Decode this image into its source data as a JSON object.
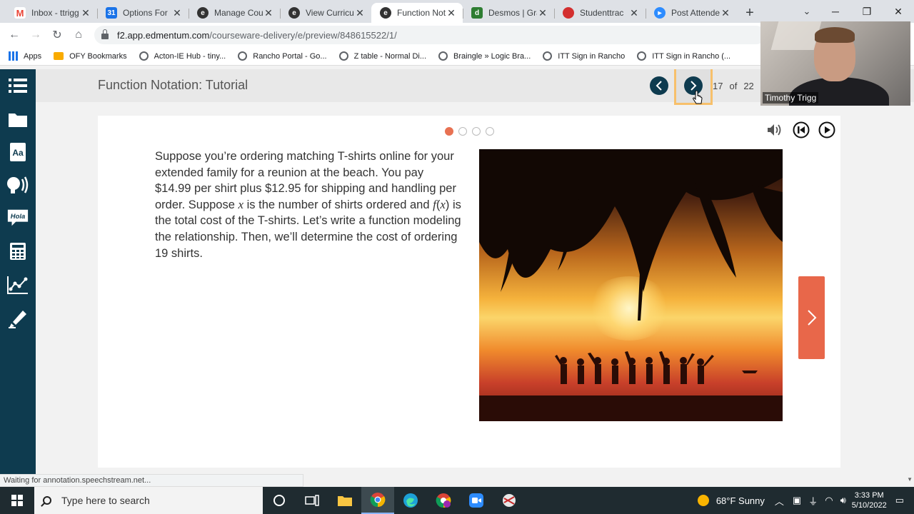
{
  "browser": {
    "tabs": [
      {
        "label": "Inbox - ttrigg",
        "icon": "gmail-icon",
        "color": "#ea4335",
        "active": false
      },
      {
        "label": "Options For",
        "icon": "calendar-icon",
        "color": "#1a73e8",
        "active": false
      },
      {
        "label": "Manage Cou",
        "icon": "edmentum-icon",
        "color": "#333333",
        "active": false
      },
      {
        "label": "View Curricu",
        "icon": "edmentum-icon",
        "color": "#333333",
        "active": false
      },
      {
        "label": "Function Not",
        "icon": "edmentum-icon",
        "color": "#333333",
        "active": true
      },
      {
        "label": "Desmos | Gra",
        "icon": "desmos-icon",
        "color": "#2e7d32",
        "active": false
      },
      {
        "label": "Studenttrac",
        "icon": "apple-icon",
        "color": "#d32f2f",
        "active": false
      },
      {
        "label": "Post Attende",
        "icon": "zoom-icon",
        "color": "#2d8cff",
        "active": false
      }
    ],
    "url_host": "f2.app.edmentum.com",
    "url_path": "/courseware-delivery/e/preview/848615522/1/",
    "bookmarks": [
      {
        "label": "Apps",
        "icon": "apps-grid-icon"
      },
      {
        "label": "OFY Bookmarks",
        "icon": "folder-icon"
      },
      {
        "label": "Acton-IE Hub - tiny...",
        "icon": "globe-icon"
      },
      {
        "label": "Rancho Portal - Go...",
        "icon": "globe-icon"
      },
      {
        "label": "Z table - Normal Di...",
        "icon": "globe-icon"
      },
      {
        "label": "Braingle » Logic Bra...",
        "icon": "globe-icon"
      },
      {
        "label": "ITT Sign in Rancho",
        "icon": "globe-icon"
      },
      {
        "label": "ITT Sign in Rancho (...",
        "icon": "globe-icon"
      }
    ],
    "status_text": "Waiting for annotation.speechstream.net..."
  },
  "lesson": {
    "title": "Function Notation: Tutorial",
    "page_current": "17",
    "page_of": "of",
    "page_total": "22",
    "slide_count": 4,
    "slide_active": 0,
    "prose": {
      "p1": "Suppose you’re ordering matching T-shirts online for your extended family for a reunion at the beach. You pay $14.99 per shirt plus $12.95 for shipping and handling per order. Suppose ",
      "var_x": "x",
      "p2": " is the number of shirts ordered and ",
      "func_f": "f",
      "paren_open": "(",
      "func_x": "x",
      "paren_close": ")",
      "p3": " is the total cost of the T-shirts. Let’s write a function modeling the relationship. Then, we’ll determine the cost of ordering 19 shirts."
    },
    "photo_description": "beach-sunset-photo",
    "accent_color": "#e8674a",
    "nav_color": "#0e3b4f"
  },
  "webcam": {
    "name": "Timothy Trigg"
  },
  "taskbar": {
    "search_placeholder": "Type here to search",
    "weather": "68°F  Sunny",
    "time": "3:33 PM",
    "date": "5/10/2022"
  }
}
